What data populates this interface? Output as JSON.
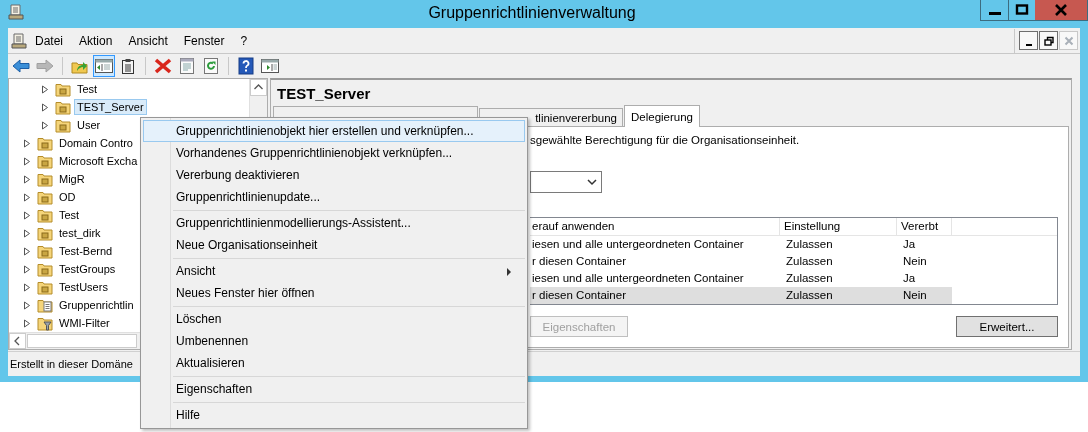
{
  "window": {
    "title": "Gruppenrichtlinienverwaltung",
    "controls": [
      {
        "kind": "minimize"
      },
      {
        "kind": "maximize"
      },
      {
        "kind": "close"
      }
    ]
  },
  "menu_bar": {
    "items": [
      "Datei",
      "Aktion",
      "Ansicht",
      "Fenster",
      "?"
    ],
    "mdi_buttons": [
      {
        "kind": "minimize",
        "disabled": false
      },
      {
        "kind": "restore",
        "disabled": false
      },
      {
        "kind": "close",
        "disabled": true
      }
    ]
  },
  "toolbar": {
    "groups": [
      [
        {
          "kind": "back",
          "pressed": false,
          "disabled": false
        },
        {
          "kind": "forward",
          "pressed": false,
          "disabled": true
        }
      ],
      [
        {
          "kind": "up",
          "pressed": false,
          "disabled": false
        },
        {
          "kind": "tree-toggle",
          "pressed": true,
          "disabled": false
        },
        {
          "kind": "export",
          "pressed": false,
          "disabled": false
        }
      ],
      [
        {
          "kind": "delete",
          "pressed": false,
          "disabled": false
        },
        {
          "kind": "properties",
          "pressed": false,
          "disabled": false
        },
        {
          "kind": "refresh",
          "pressed": false,
          "disabled": false
        }
      ],
      [
        {
          "kind": "help",
          "pressed": false,
          "disabled": false
        },
        {
          "kind": "action-pane",
          "pressed": false,
          "disabled": false
        }
      ]
    ]
  },
  "tree": {
    "items": [
      {
        "children": [
          {
            "label": "Test",
            "kind": "ou",
            "expanded": false,
            "selected": false
          },
          {
            "label": "TEST_Server",
            "kind": "ou",
            "expanded": false,
            "selected": true
          },
          {
            "label": "User",
            "kind": "ou",
            "expanded": false,
            "selected": false
          }
        ]
      },
      {
        "label": "Domain Contro",
        "kind": "ou",
        "expanded": false,
        "selected": false
      },
      {
        "label": "Microsoft Excha",
        "kind": "ou",
        "expanded": false,
        "selected": false
      },
      {
        "label": "MigR",
        "kind": "ou",
        "expanded": false,
        "selected": false
      },
      {
        "label": "OD",
        "kind": "ou",
        "expanded": false,
        "selected": false
      },
      {
        "label": "Test",
        "kind": "ou",
        "expanded": false,
        "selected": false
      },
      {
        "label": "test_dirk",
        "kind": "ou",
        "expanded": false,
        "selected": false
      },
      {
        "label": "Test-Bernd",
        "kind": "ou",
        "expanded": false,
        "selected": false
      },
      {
        "label": "TestGroups",
        "kind": "ou",
        "expanded": false,
        "selected": false
      },
      {
        "label": "TestUsers",
        "kind": "ou",
        "expanded": false,
        "selected": false
      },
      {
        "label": "Gruppenrichtlin",
        "kind": "gpo",
        "expanded": false,
        "selected": false
      },
      {
        "label": "WMI-Filter",
        "kind": "wmi",
        "expanded": false,
        "selected": false
      }
    ]
  },
  "details": {
    "title": "TEST_Server",
    "tabs": [
      {
        "selected": false
      },
      {
        "label": "tlinienvererbung",
        "selected": false
      },
      {
        "label": "Delegierung",
        "selected": true
      }
    ],
    "description": "sgewählte Berechtigung für die Organisationseinheit.",
    "table": {
      "columns": [
        "erauf anwenden",
        "Einstellung",
        "Vererbt"
      ],
      "rows": [
        {
          "cells": [
            "iesen und alle untergeordneten Container",
            "Zulassen",
            "Ja"
          ],
          "selected": false
        },
        {
          "cells": [
            "r diesen Container",
            "Zulassen",
            "Nein"
          ],
          "selected": false
        },
        {
          "cells": [
            "iesen und alle untergeordneten Container",
            "Zulassen",
            "Ja"
          ],
          "selected": false
        },
        {
          "cells": [
            "r diesen Container",
            "Zulassen",
            "Nein"
          ],
          "selected": true
        }
      ]
    },
    "buttons": [
      {
        "label": "Eigenschaften",
        "disabled": true
      },
      {
        "label": "Erweitert...",
        "disabled": false
      }
    ]
  },
  "status_bar": {
    "text": "Erstellt in dieser Domäne"
  },
  "context_menu": {
    "groups": [
      [
        {
          "label": "Gruppenrichtlinienobjekt hier erstellen und verknüpfen...",
          "selected": true,
          "submenu": false
        },
        {
          "label": "Vorhandenes Gruppenrichtlinienobjekt verknüpfen...",
          "selected": false,
          "submenu": false
        },
        {
          "label": "Vererbung deaktivieren",
          "selected": false,
          "submenu": false
        },
        {
          "label": "Gruppenrichtlinienupdate...",
          "selected": false,
          "submenu": false
        }
      ],
      [
        {
          "label": "Gruppenrichtlinienmodellierungs-Assistent...",
          "selected": false,
          "submenu": false
        },
        {
          "label": "Neue Organisationseinheit",
          "selected": false,
          "submenu": false
        }
      ],
      [
        {
          "label": "Ansicht",
          "selected": false,
          "submenu": true
        },
        {
          "label": "Neues Fenster hier öffnen",
          "selected": false,
          "submenu": false
        }
      ],
      [
        {
          "label": "Löschen",
          "selected": false,
          "submenu": false
        },
        {
          "label": "Umbenennen",
          "selected": false,
          "submenu": false
        },
        {
          "label": "Aktualisieren",
          "selected": false,
          "submenu": false
        }
      ],
      [
        {
          "label": "Eigenschaften",
          "selected": false,
          "submenu": false
        }
      ],
      [
        {
          "label": "Hilfe",
          "selected": false,
          "submenu": false
        }
      ]
    ]
  }
}
